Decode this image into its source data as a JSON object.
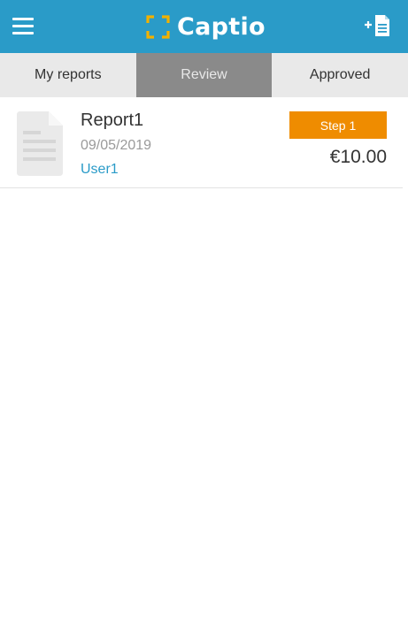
{
  "app": {
    "title": "Captio",
    "brand_color": "#2a9bc8",
    "accent_color": "#ef8c00"
  },
  "header": {
    "menu_icon": "hamburger-menu-icon",
    "add_report_icon": "add-report-icon"
  },
  "tabs": [
    {
      "label": "My reports",
      "active": false
    },
    {
      "label": "Review",
      "active": true
    },
    {
      "label": "Approved",
      "active": false
    }
  ],
  "reports": [
    {
      "name": "Report1",
      "date": "09/05/2019",
      "user": "User1",
      "status": "Step 1",
      "amount": "€10.00",
      "icon": "document-icon"
    }
  ]
}
